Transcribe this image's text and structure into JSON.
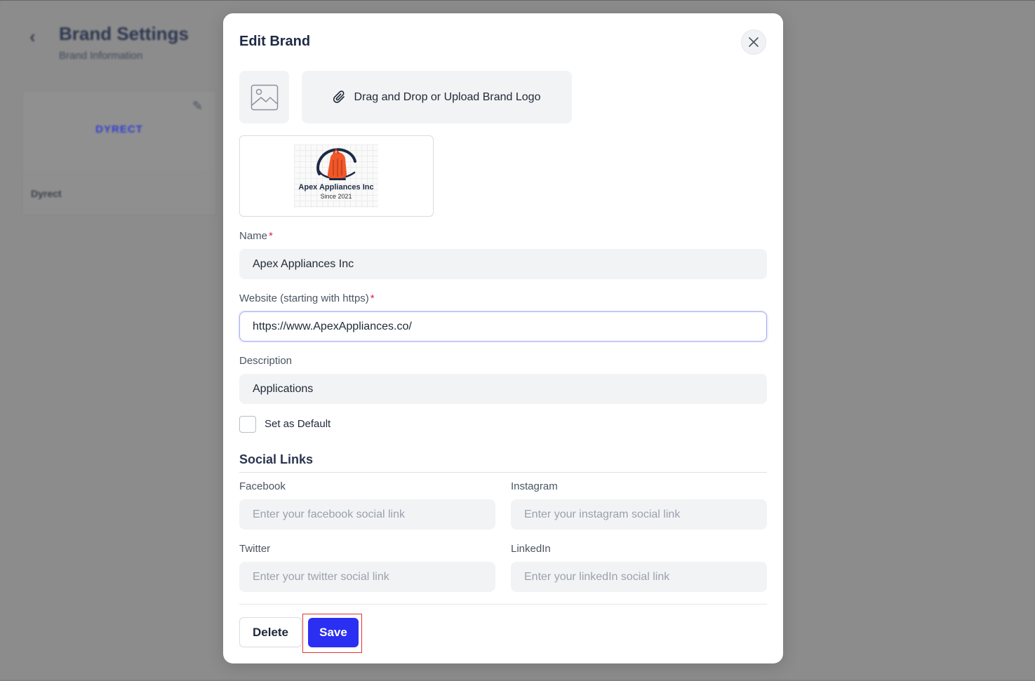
{
  "background": {
    "title": "Brand Settings",
    "subtitle": "Brand Information",
    "card": {
      "logo_text": "DYRECT",
      "name": "Dyrect"
    }
  },
  "modal": {
    "title": "Edit Brand",
    "upload_label": "Drag and Drop or Upload Brand Logo",
    "preview": {
      "brand_text": "Apex Appliances Inc",
      "since_text": "Since 2021"
    },
    "fields": {
      "name": {
        "label": "Name",
        "required_mark": "*",
        "value": "Apex Appliances Inc"
      },
      "website": {
        "label": "Website (starting with https)",
        "required_mark": "*",
        "value": "https://www.ApexAppliances.co/"
      },
      "description": {
        "label": "Description",
        "value": "Applications"
      }
    },
    "default_checkbox": {
      "label": "Set as Default",
      "checked": false
    },
    "social": {
      "title": "Social Links",
      "facebook": {
        "label": "Facebook",
        "placeholder": "Enter your facebook social link"
      },
      "instagram": {
        "label": "Instagram",
        "placeholder": "Enter your instagram social link"
      },
      "twitter": {
        "label": "Twitter",
        "placeholder": "Enter your twitter social link"
      },
      "linkedin": {
        "label": "LinkedIn",
        "placeholder": "Enter your linkedIn social link"
      }
    },
    "buttons": {
      "delete": "Delete",
      "save": "Save"
    }
  },
  "colors": {
    "primary": "#2b2ff2",
    "required": "#e11d48",
    "highlight": "#e03535",
    "logo_orange": "#f0582a",
    "logo_navy": "#1e2a44"
  },
  "icons": {
    "back": "chevron-left-icon",
    "close": "close-icon",
    "image": "image-icon",
    "attach": "paperclip-icon",
    "edit": "pencil-icon"
  }
}
